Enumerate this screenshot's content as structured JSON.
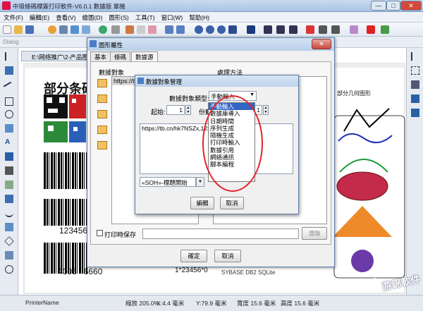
{
  "window": {
    "title": "中琅條碼標簽打印軟件-V6.0.1 數據版 單機",
    "min_label": "—",
    "max_label": "□",
    "close_label": "✕"
  },
  "menu": [
    "文件(F)",
    "編輯(E)",
    "查看(V)",
    "繪圖(D)",
    "圖形(S)",
    "工具(T)",
    "窗口(W)",
    "幫助(H)"
  ],
  "dialog_toolbar": {
    "label": "Dialog"
  },
  "document": {
    "tab_label": "E:\\网络推广\\2-产品图"
  },
  "canvas": {
    "heading": "部分条码",
    "barcode_text_1": "123456",
    "barcode_text_2": "4006   6660",
    "barcode_text_3": "1*23456*0",
    "shapes_title": "部分几何图形",
    "footer_logos": "SYBASE  DB2  SQLite"
  },
  "property_dialog": {
    "title": "圖形屬性",
    "tabs": [
      "基本",
      "條碼",
      "數據源"
    ],
    "active_tab": "數據源",
    "data_object_label": "數據對象",
    "process_label": "處理方法",
    "list_row": "https://t",
    "print_save_label": "打印時保存",
    "clear_label": "清除",
    "ok_label": "確定",
    "cancel_label": "取消"
  },
  "data_dialog": {
    "title": "數據對象管理",
    "type_label": "數據對象類型:",
    "type_value": "手動輸入",
    "start_label": "起始:",
    "start_value": "1",
    "digits_label": "份數",
    "digits_value": "1",
    "content": "https://tb.cn/hk7NSZx,123*",
    "soh_value": "«SOH»-標題開始",
    "edit_label": "編輯",
    "cancel_label": "取消"
  },
  "dropdown_options": [
    "手動輸入",
    "數據庫導入",
    "日期時間",
    "序列生成",
    "隨機生成",
    "打印時輸入",
    "數據引用",
    "網絡通訊",
    "腳本編程"
  ],
  "status": {
    "printer": "PrinterName",
    "zoom": "縮放 205.0%",
    "x": "X:4.4 毫米",
    "y": "Y:79.9 毫米",
    "width": "寬度 15.6 毫米",
    "height": "高度 15.6 毫米"
  },
  "watermark": "游錦軟件",
  "colors": {
    "accent": "#3166c5",
    "highlight_circle": "#e2232a"
  }
}
